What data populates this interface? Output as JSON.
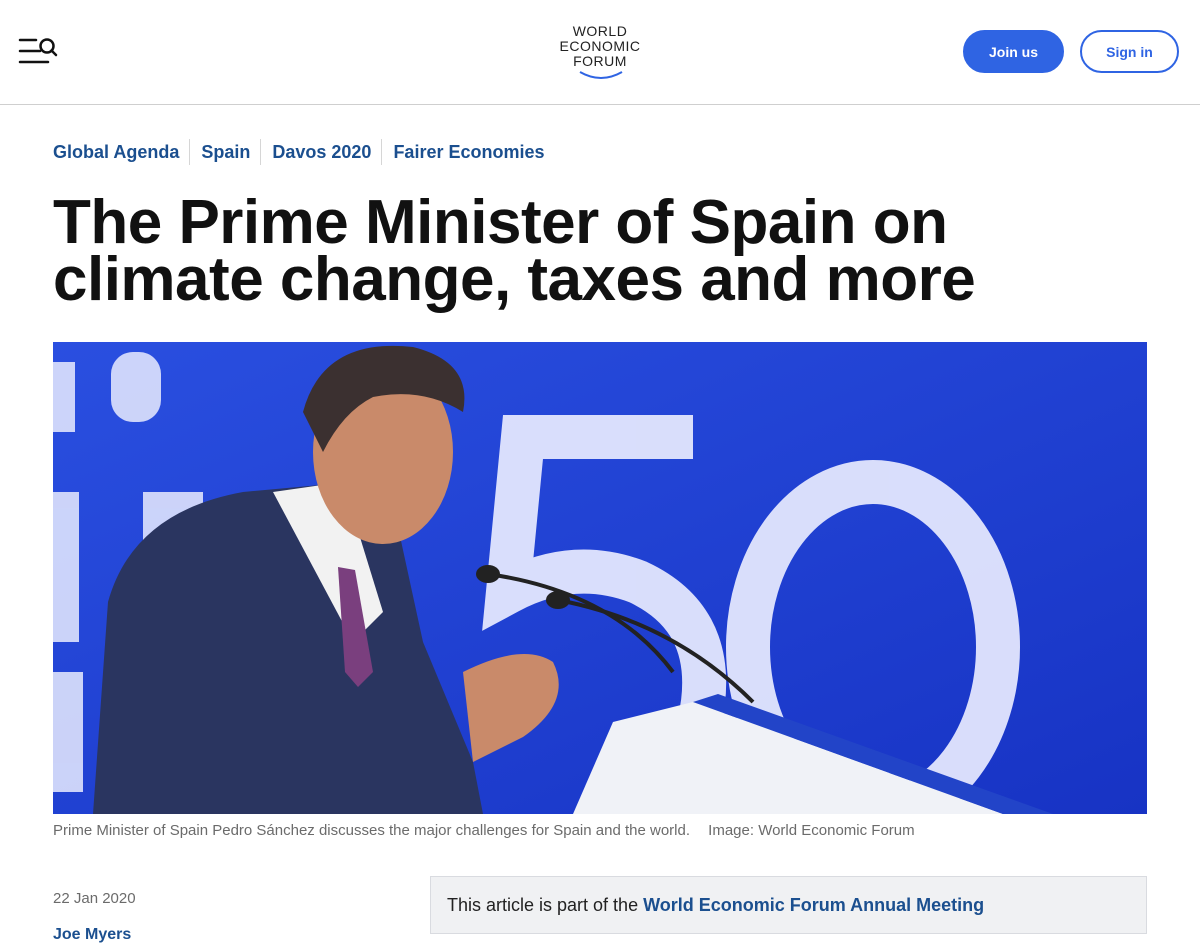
{
  "header": {
    "logo_lines": [
      "WORLD",
      "ECONOMIC",
      "FORUM"
    ],
    "join_label": "Join us",
    "signin_label": "Sign in"
  },
  "tags": [
    "Global Agenda",
    "Spain",
    "Davos 2020",
    "Fairer Economies"
  ],
  "article": {
    "title": "The Prime Minister of Spain on climate change, taxes and more",
    "image_caption": "Prime Minister of Spain Pedro Sánchez discusses the major challenges for Spain and the world.",
    "image_credit": "Image: World Economic Forum",
    "date": "22 Jan 2020",
    "author": "Joe Myers"
  },
  "notice": {
    "text": "This article is part of the",
    "link": "World Economic Forum Annual Meeting"
  },
  "colors": {
    "accent": "#2f64e3",
    "tag_text": "#1b4f8f",
    "hero_blue": "#1e3fd6"
  },
  "icons": {
    "menu": "menu-search-icon"
  }
}
